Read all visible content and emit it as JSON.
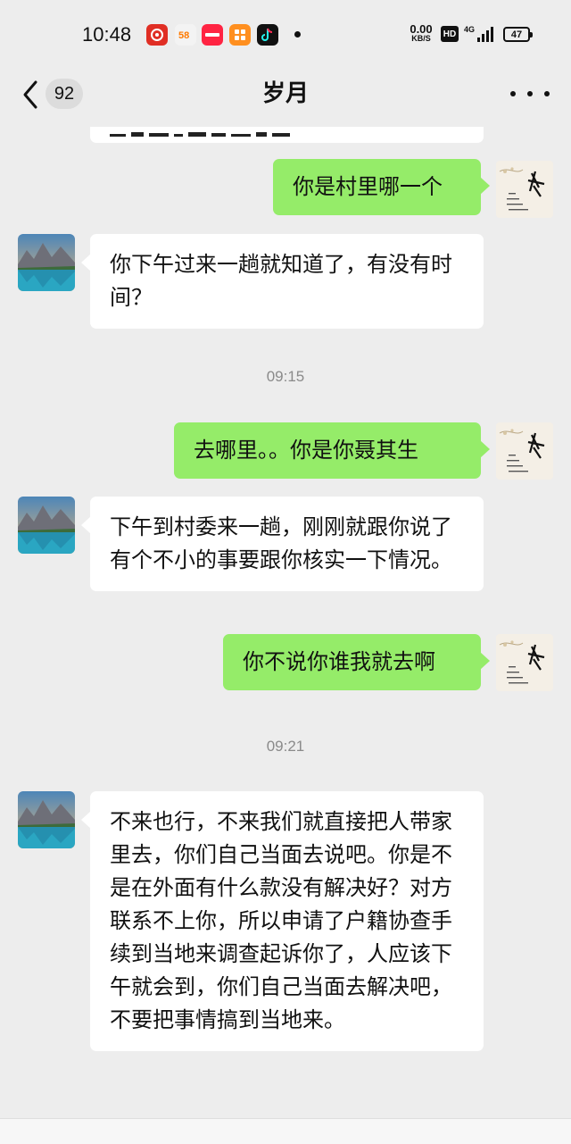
{
  "status_bar": {
    "time": "10:48",
    "app_icons": [
      "pinduoduo-icon",
      "58-icon",
      "xiaohongshu-icon",
      "meituan-icon",
      "douyin-icon"
    ],
    "net_speed_value": "0.00",
    "net_speed_unit": "KB/S",
    "hd_label": "HD",
    "signal_label": "4G",
    "battery_level": "47"
  },
  "nav": {
    "unread_count": "92",
    "title": "岁月"
  },
  "messages": [
    {
      "type": "cut",
      "side": "in"
    },
    {
      "type": "text",
      "side": "out",
      "text": "你是村里哪一个"
    },
    {
      "type": "text",
      "side": "in",
      "text": "你下午过来一趟就知道了，有没有时间？"
    },
    {
      "type": "time",
      "text": "09:15"
    },
    {
      "type": "text",
      "side": "out",
      "text": "去哪里。。你是你聂其生"
    },
    {
      "type": "text",
      "side": "in",
      "text": "下午到村委来一趟，刚刚就跟你说了有个不小的事要跟你核实一下情况。"
    },
    {
      "type": "text",
      "side": "out",
      "text": "你不说你谁我就去啊"
    },
    {
      "type": "time",
      "text": "09:21"
    },
    {
      "type": "text",
      "side": "in",
      "text": "不来也行，不来我们就直接把人带家里去，你们自己当面去说吧。你是不是在外面有什么款没有解决好？对方联系不上你，所以申请了户籍协查手续到当地来调查起诉你了，人应该下午就会到，你们自己当面去解决吧，不要把事情搞到当地来。"
    }
  ],
  "colors": {
    "background": "#ededed",
    "incoming_bubble": "#ffffff",
    "outgoing_bubble": "#95ec69",
    "timestamp_text": "#8a8a8a"
  }
}
